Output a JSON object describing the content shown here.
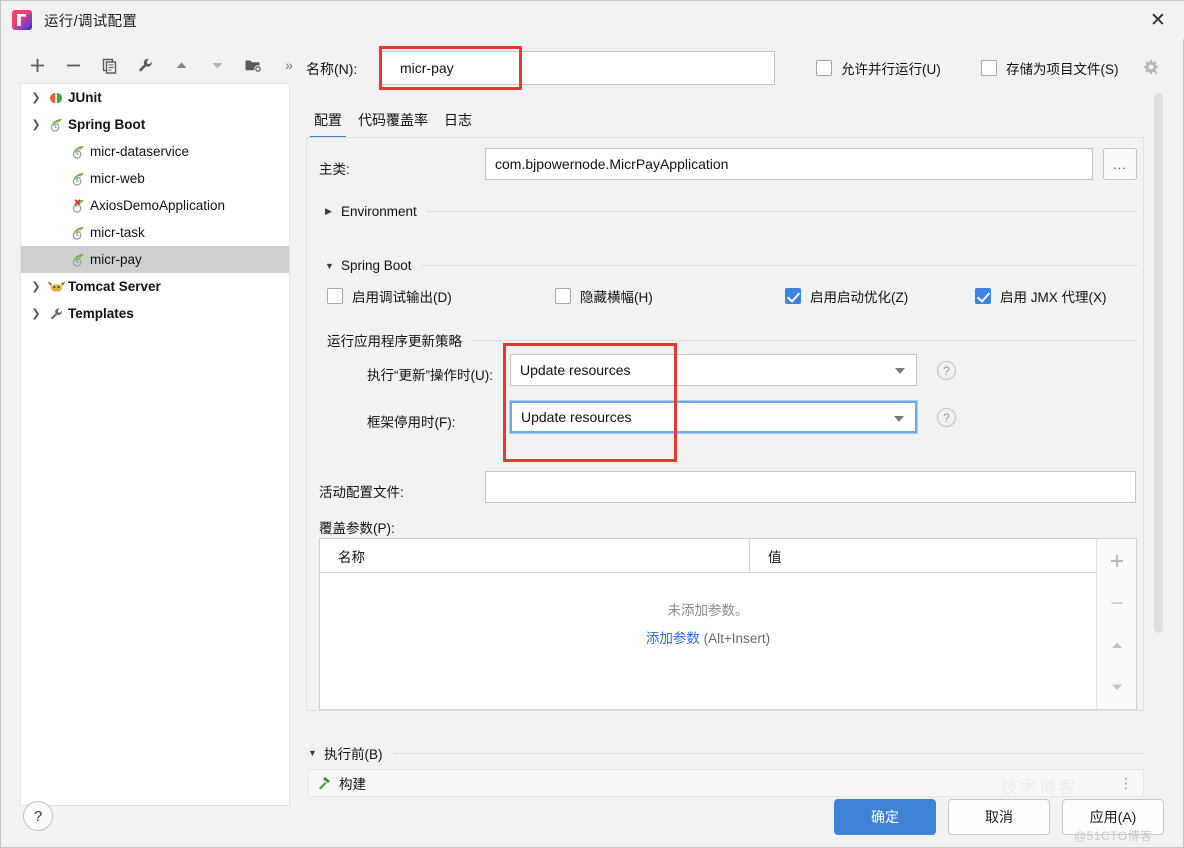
{
  "window": {
    "title": "运行/调试配置",
    "app_icon": "intellij-idea-icon",
    "close_label": "✕"
  },
  "toolbar": {
    "buttons": [
      {
        "name": "add-configuration-button",
        "icon": "plus-icon"
      },
      {
        "name": "remove-configuration-button",
        "icon": "minus-icon"
      },
      {
        "name": "copy-configuration-button",
        "icon": "copy-icon"
      },
      {
        "name": "edit-templates-button",
        "icon": "wrench-icon"
      },
      {
        "name": "move-up-button",
        "icon": "triangle-up-icon"
      },
      {
        "name": "move-down-button",
        "icon": "triangle-down-icon"
      },
      {
        "name": "new-folder-button",
        "icon": "folder-add-icon"
      },
      {
        "name": "more-options-button",
        "icon": "chevron-double-right-icon"
      }
    ],
    "more_glyph": "»"
  },
  "tree": {
    "items": [
      {
        "label": "JUnit",
        "icon": "junit-icon",
        "level": 0,
        "expander": "chevron-right-icon",
        "bold": true,
        "selected": false
      },
      {
        "label": "Spring Boot",
        "icon": "spring-icon",
        "level": 0,
        "expander": "chevron-down-icon",
        "bold": true,
        "selected": false
      },
      {
        "label": "micr-dataservice",
        "icon": "spring-icon",
        "level": 1,
        "expander": "",
        "bold": false,
        "selected": false
      },
      {
        "label": "micr-web",
        "icon": "spring-icon",
        "level": 1,
        "expander": "",
        "bold": false,
        "selected": false
      },
      {
        "label": "AxiosDemoApplication",
        "icon": "spring-error-icon",
        "level": 1,
        "expander": "",
        "bold": false,
        "selected": false
      },
      {
        "label": "micr-task",
        "icon": "spring-icon",
        "level": 1,
        "expander": "",
        "bold": false,
        "selected": false
      },
      {
        "label": "micr-pay",
        "icon": "spring-icon",
        "level": 1,
        "expander": "",
        "bold": false,
        "selected": true
      },
      {
        "label": "Tomcat Server",
        "icon": "tomcat-icon",
        "level": 0,
        "expander": "chevron-right-icon",
        "bold": true,
        "selected": false
      },
      {
        "label": "Templates",
        "icon": "wrench-icon",
        "level": 0,
        "expander": "chevron-right-icon",
        "bold": true,
        "selected": false
      }
    ]
  },
  "help_button": {
    "glyph": "?"
  },
  "name_row": {
    "label": "名称(N):",
    "value": "micr-pay",
    "allow_parallel_label": "允许并行运行(U)",
    "allow_parallel_checked": false,
    "store_as_project_file_label": "存储为项目文件(S)",
    "store_as_project_file_checked": false,
    "gear_icon": "gear-dropdown-icon"
  },
  "tabs": [
    {
      "label": "配置",
      "active": true
    },
    {
      "label": "代码覆盖率",
      "active": false
    },
    {
      "label": "日志",
      "active": false
    }
  ],
  "config": {
    "main_class_label": "主类:",
    "main_class_value": "com.bjpowernode.MicrPayApplication",
    "main_class_browse": "...",
    "environment_section": {
      "title": "Environment",
      "expanded": false,
      "triangle": "▶"
    },
    "spring_boot_section": {
      "title": "Spring Boot",
      "expanded": true,
      "triangle": "▼"
    },
    "checkboxes": [
      {
        "label": "启用调试输出(D)",
        "checked": false,
        "name": "enable-debug-output"
      },
      {
        "label": "隐藏横幅(H)",
        "checked": false,
        "name": "hide-banner"
      },
      {
        "label": "启用启动优化(Z)",
        "checked": true,
        "name": "enable-launch-optimization"
      },
      {
        "label": "启用 JMX 代理(X)",
        "checked": true,
        "name": "enable-jmx-agent"
      }
    ],
    "update_policy_group_title": "运行应用程序更新策略",
    "on_update_label": "执行“更新”操作时(U):",
    "on_update_value": "Update resources",
    "on_frame_label": "框架停用时(F):",
    "on_frame_value": "Update resources",
    "help_glyph": "?",
    "active_profiles_label": "活动配置文件:",
    "active_profiles_value": "",
    "override_params_label": "覆盖参数(P):",
    "table": {
      "columns": [
        "名称",
        "值"
      ],
      "rows": [],
      "empty_text": "未添加参数。",
      "empty_link": "添加参数",
      "empty_hint": " (Alt+Insert)",
      "side_buttons": [
        {
          "name": "add-parameter-button",
          "icon": "plus-icon"
        },
        {
          "name": "remove-parameter-button",
          "icon": "minus-icon"
        },
        {
          "name": "move-parameter-up-button",
          "icon": "triangle-up-icon"
        },
        {
          "name": "move-parameter-down-button",
          "icon": "triangle-down-icon"
        }
      ]
    }
  },
  "before_launch": {
    "title": "执行前(B)",
    "triangle": "▼",
    "first_task_label": "构建",
    "first_task_icon": "build-hammer-icon",
    "more_glyph": "⋮"
  },
  "footer": {
    "ok": "确定",
    "cancel": "取消",
    "apply": "应用(A)"
  },
  "watermark": "@51CTO博客",
  "watermark_faint": "技术博客",
  "colors": {
    "accent": "#3f83d6",
    "highlight_box": "#e8382f",
    "checkbox_checked": "#3d83e3",
    "link": "#2d6fc4",
    "tab_underline": "#3b7ddd",
    "dialog_bg": "#f2f2f2",
    "selection": "#cfcfcf"
  }
}
